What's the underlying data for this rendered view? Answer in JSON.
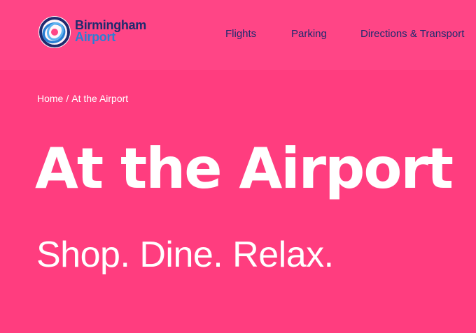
{
  "header": {
    "logo": {
      "line1": "Birmingham",
      "line2": "Airport",
      "icon": "airport-logo-rings-icon"
    },
    "nav": [
      {
        "label": "Flights"
      },
      {
        "label": "Parking"
      },
      {
        "label": "Directions & Transport"
      }
    ]
  },
  "breadcrumb": {
    "home": "Home",
    "separator": "/",
    "current": "At the Airport"
  },
  "hero": {
    "title": "At the Airport",
    "subtitle": "Shop. Dine. Relax."
  },
  "colors": {
    "background": "#ff3d7f",
    "header_background": "#ff4586",
    "navy": "#1f2a6e",
    "blue": "#2a7fd4",
    "text_light": "#ffffff"
  }
}
